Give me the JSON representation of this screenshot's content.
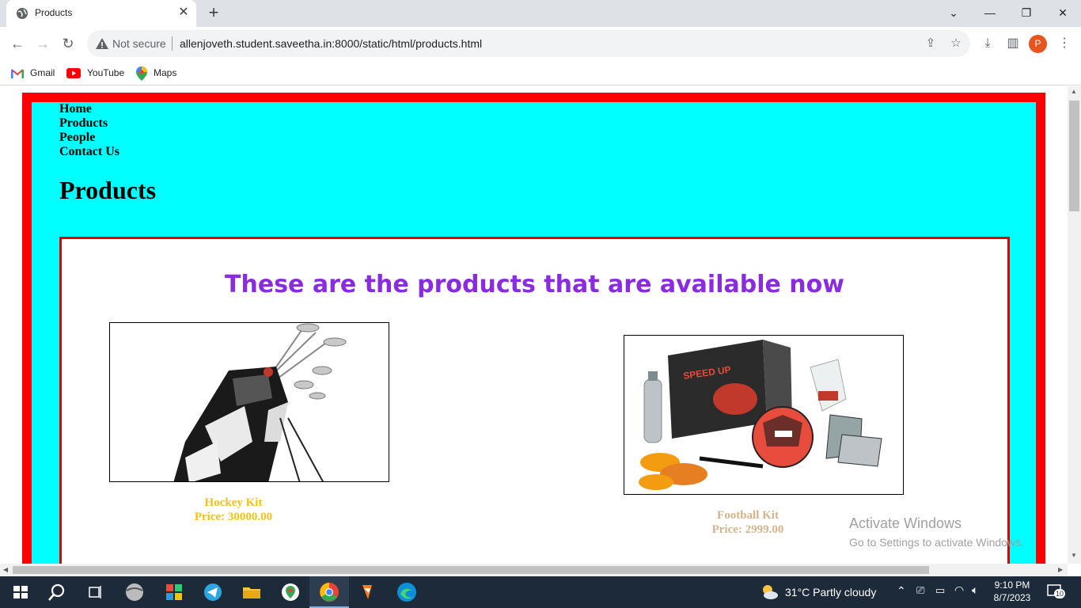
{
  "browser": {
    "tab_title": "Products",
    "security_label": "Not secure",
    "url": "allenjoveth.student.saveetha.in:8000/static/html/products.html",
    "profile_initial": "P",
    "bookmarks": [
      {
        "label": "Gmail"
      },
      {
        "label": "YouTube"
      },
      {
        "label": "Maps"
      }
    ]
  },
  "page": {
    "nav": [
      "Home",
      "Products",
      "People",
      "Contact Us"
    ],
    "title": "Products",
    "heading": "These are the products that are available now",
    "products": [
      {
        "name": "Hockey Kit",
        "price": "Price: 30000.00",
        "color": "#f2c21a"
      },
      {
        "name": "Football Kit",
        "price": "Price: 2999.00",
        "color": "#d2b48c"
      }
    ],
    "colors": {
      "outer_border": "#ff0000",
      "inner_background": "#00ffff",
      "panel_border": "#e00000",
      "heading": "#8a2be2"
    }
  },
  "watermark": {
    "line1": "Activate Windows",
    "line2": "Go to Settings to activate Windows."
  },
  "taskbar": {
    "weather": "31°C  Partly cloudy",
    "time": "9:10 PM",
    "date": "8/7/2023",
    "notification_count": "10"
  }
}
